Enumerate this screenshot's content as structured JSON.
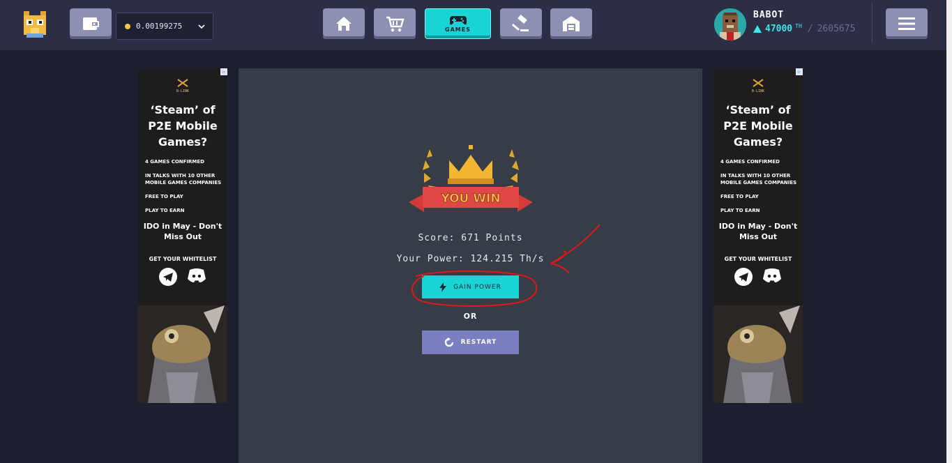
{
  "header": {
    "wallet_balance": "0.00199275",
    "nav": [
      {
        "id": "home",
        "label": ""
      },
      {
        "id": "market",
        "label": ""
      },
      {
        "id": "games",
        "label": "GAMES"
      },
      {
        "id": "auction",
        "label": ""
      },
      {
        "id": "storage",
        "label": ""
      }
    ],
    "user": {
      "name": "BABOT",
      "power": "47000",
      "power_unit": "TH",
      "power_separator": "/",
      "power_total": "2605675"
    }
  },
  "ad": {
    "brand": "B-LINK",
    "headline": "‘Steam’ of P2E Mobile Games?",
    "bullets": [
      "4 GAMES CONFIRMED",
      "IN TALKS WITH 10 OTHER MOBILE GAMES COMPANIES",
      "FREE TO PLAY",
      "PLAY TO EARN"
    ],
    "ido": "IDO in May - Don't Miss Out",
    "whitelist": "GET YOUR WHITELIST"
  },
  "game": {
    "banner": "YOU WIN",
    "score": "Score: 671 Points",
    "your_power": "Your Power: 124.215 Th/s",
    "gain_power_label": "GAIN POWER",
    "or_label": "OR",
    "restart_label": "RESTART"
  },
  "colors": {
    "accent": "#18d4d4",
    "nav_button": "#8d8fb3",
    "restart": "#7b7ec0",
    "annotation": "#e01818"
  }
}
